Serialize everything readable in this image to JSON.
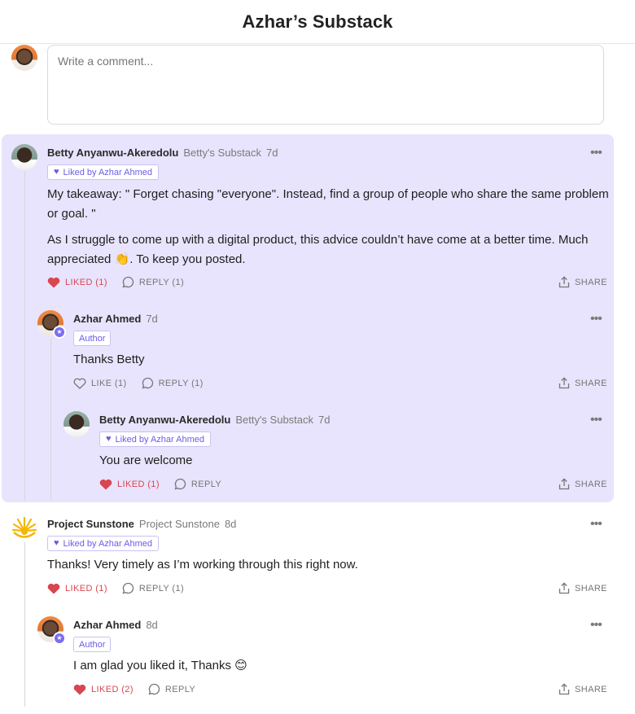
{
  "header": {
    "title": "Azhar’s Substack"
  },
  "compose": {
    "placeholder": "Write a comment..."
  },
  "comments": [
    {
      "name": "Betty Anyanwu-Akeredolu",
      "publication": "Betty's Substack",
      "time": "7d",
      "liked_by": "Liked by Azhar Ahmed",
      "paragraphs": [
        "My takeaway: \" Forget chasing \"everyone\". Instead, find a group of people who share the same problem or goal. \"",
        "As I struggle to come up with a digital product, this advice couldn’t have come at a better time. Much appreciated 👏. To keep you posted."
      ],
      "like_label": "LIKED (1)",
      "reply_label": "REPLY (1)",
      "share_label": "SHARE",
      "replies": [
        {
          "name": "Azhar Ahmed",
          "time": "7d",
          "badge": "Author",
          "text": "Thanks Betty",
          "like_label": "LIKE (1)",
          "reply_label": "REPLY (1)",
          "share_label": "SHARE",
          "replies": [
            {
              "name": "Betty Anyanwu-Akeredolu",
              "publication": "Betty's Substack",
              "time": "7d",
              "liked_by": "Liked by Azhar Ahmed",
              "text": "You are welcome",
              "like_label": "LIKED (1)",
              "reply_label": "REPLY",
              "share_label": "SHARE"
            }
          ]
        }
      ]
    },
    {
      "name": "Project Sunstone",
      "publication": "Project Sunstone",
      "time": "8d",
      "liked_by": "Liked by Azhar Ahmed",
      "text": "Thanks! Very timely as I’m working through this right now.",
      "like_label": "LIKED (1)",
      "reply_label": "REPLY (1)",
      "share_label": "SHARE",
      "replies": [
        {
          "name": "Azhar Ahmed",
          "time": "8d",
          "badge": "Author",
          "text": "I am glad you liked it, Thanks 😊",
          "like_label": "LIKED (2)",
          "reply_label": "REPLY",
          "share_label": "SHARE"
        }
      ]
    }
  ],
  "colors": {
    "accent": "#6b5ce7",
    "liked": "#d8464f",
    "highlight_bg": "#e8e4fd"
  }
}
